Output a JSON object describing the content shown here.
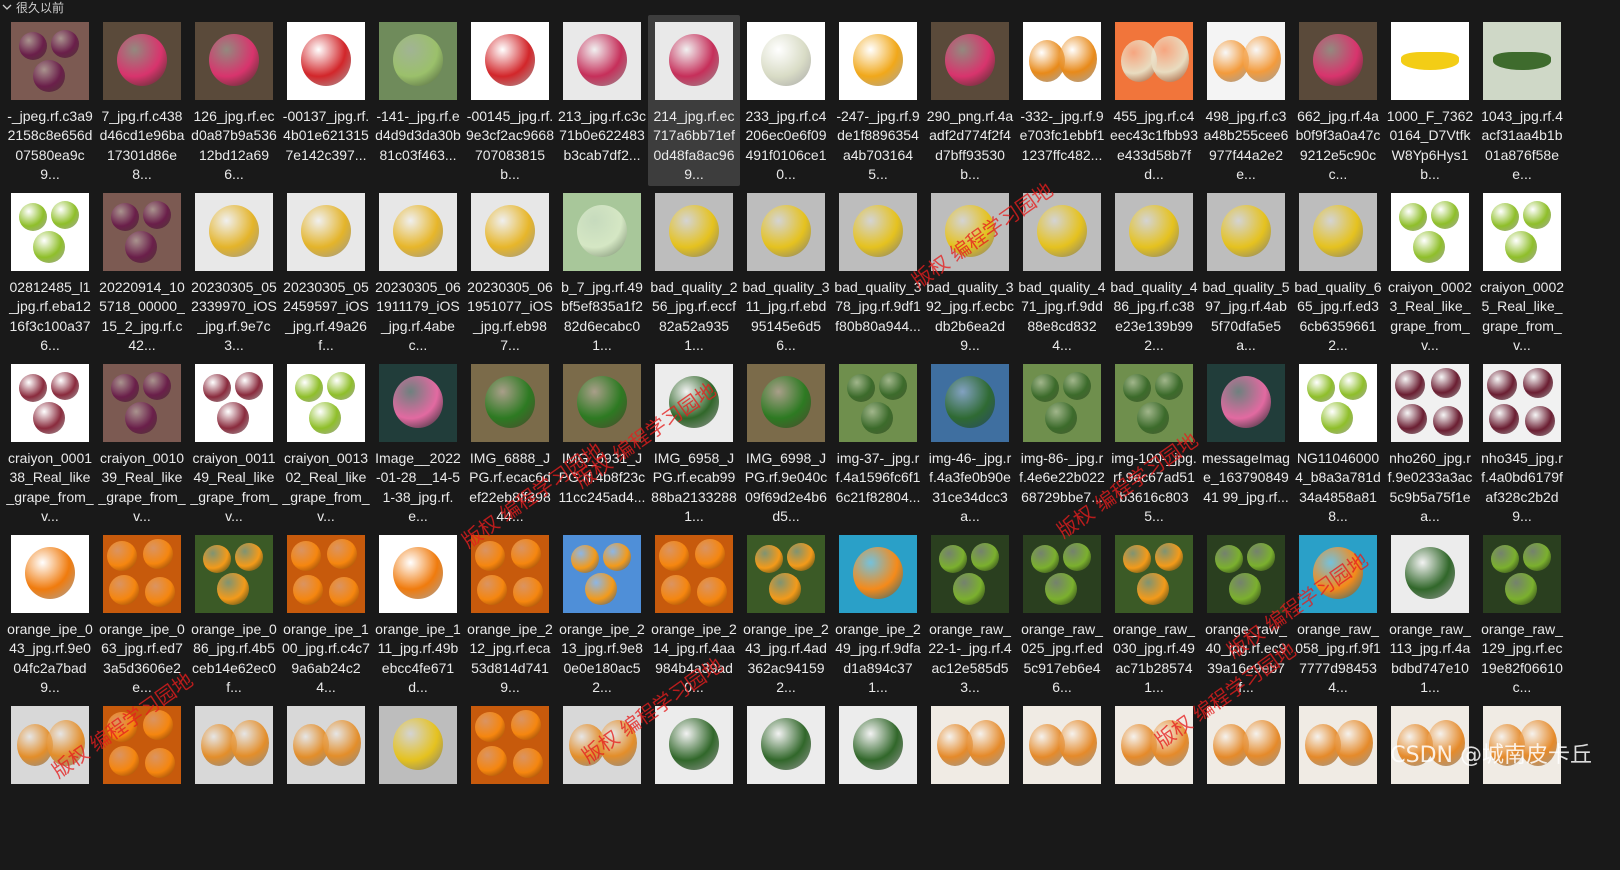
{
  "group": {
    "label": "很久以前"
  },
  "files": [
    {
      "name": "-_jpeg.rf.c3a92158c8e656d07580ea9c9...",
      "thumb": "grapes-purple"
    },
    {
      "name": "7_jpg.rf.c438d46cd1e96ba17301d86e8...",
      "thumb": "dragonfruit"
    },
    {
      "name": "126_jpg.rf.ecd0a87b9a53612bd12a696...",
      "thumb": "dragonfruit"
    },
    {
      "name": "-00137_jpg.rf.4b01e6213157e142c397...",
      "thumb": "apple-red"
    },
    {
      "name": "-141-_jpg.rf.ed4d9d3da30b81c03f463...",
      "thumb": "mango-green"
    },
    {
      "name": "-00145_jpg.rf.9e3cf2ac9668707083815b...",
      "thumb": "apple-red"
    },
    {
      "name": "213_jpg.rf.c3c71b0e622483b3cab7df2...",
      "thumb": "dragonfruit-table"
    },
    {
      "name": "214_jpg.rf.ec717a6bb71ef0d48fa8ac969...",
      "thumb": "dragonfruit-table",
      "selected": true
    },
    {
      "name": "233_jpg.rf.c4206ec0e6f09491f0106ce10...",
      "thumb": "melon"
    },
    {
      "name": "-247-_jpg.rf.9de1f8896354a4b7031645...",
      "thumb": "mango-yellow"
    },
    {
      "name": "290_png.rf.4aadf2d774f2f4d7bff93530b...",
      "thumb": "dragonfruit"
    },
    {
      "name": "-332-_jpg.rf.9e703fc1ebbf11237ffc482...",
      "thumb": "persimmon"
    },
    {
      "name": "455_jpg.rf.c4eec43c1fbb93e433d58b7fd...",
      "thumb": "melon-slices"
    },
    {
      "name": "498_jpg.rf.c3a48b255cee6977f44a2e2e...",
      "thumb": "cantaloupe"
    },
    {
      "name": "662_jpg.rf.4ab0f9f3a0a47c9212e5c90cc...",
      "thumb": "dragonfruit"
    },
    {
      "name": "1000_F_73620164_D7VtfkW8Yp6Hys1b...",
      "thumb": "banana"
    },
    {
      "name": "1043_jpg.rf.4acf31aa4b1b01a876f58ee...",
      "thumb": "leaf"
    },
    {
      "name": "02812485_l1_jpg.rf.eba1216f3c100a376...",
      "thumb": "grapes-green"
    },
    {
      "name": "20220914_105718_00000_15_2_jpg.rf.c42...",
      "thumb": "grapes-purple"
    },
    {
      "name": "20230305_052339970_iOS_jpg.rf.9e7c3...",
      "thumb": "lemon-spot"
    },
    {
      "name": "20230305_052459597_iOS_jpg.rf.49a26f...",
      "thumb": "lemon-spot"
    },
    {
      "name": "20230305_061911179_iOS_jpg.rf.4abec...",
      "thumb": "lemon-dots"
    },
    {
      "name": "20230305_061951077_iOS_jpg.rf.eb987...",
      "thumb": "lemon-dots"
    },
    {
      "name": "b_7_jpg.rf.49bf5ef835a1f282d6ecabc01...",
      "thumb": "pale-green"
    },
    {
      "name": "bad_quality_256_jpg.rf.eccf82a52a9351...",
      "thumb": "lemon-bad"
    },
    {
      "name": "bad_quality_311_jpg.rf.ebd95145e6d56...",
      "thumb": "lemon-bad"
    },
    {
      "name": "bad_quality_378_jpg.rf.9df1f80b80a944...",
      "thumb": "lemon-bad"
    },
    {
      "name": "bad_quality_392_jpg.rf.ecbcdb2b6ea2d9...",
      "thumb": "lemon-bad"
    },
    {
      "name": "bad_quality_471_jpg.rf.9dd88e8cd8324...",
      "thumb": "lemon-bad"
    },
    {
      "name": "bad_quality_486_jpg.rf.c38e23e139b992...",
      "thumb": "lemon-bad"
    },
    {
      "name": "bad_quality_597_jpg.rf.4ab5f70dfa5e5a...",
      "thumb": "lemon-bad"
    },
    {
      "name": "bad_quality_665_jpg.rf.ed36cb63596612...",
      "thumb": "lemon-bad"
    },
    {
      "name": "craiyon_00023_Real_like_grape_from_v...",
      "thumb": "grapes-green"
    },
    {
      "name": "craiyon_00025_Real_like_grape_from_v...",
      "thumb": "grapes-green"
    },
    {
      "name": "craiyon_000138_Real_like_grape_from_v...",
      "thumb": "grapes-red"
    },
    {
      "name": "craiyon_001039_Real_like_grape_from_v...",
      "thumb": "grapes-purple"
    },
    {
      "name": "craiyon_001149_Real_like_grape_from_v...",
      "thumb": "grapes-red"
    },
    {
      "name": "craiyon_001302_Real_like_grape_from_v...",
      "thumb": "grapes-green"
    },
    {
      "name": "Image__2022-01-28__14-51-38_jpg.rf.e...",
      "thumb": "dragonfruit-dark"
    },
    {
      "name": "IMG_6888_JPG.rf.ecac6def22eb8ff39844...",
      "thumb": "lime-mat"
    },
    {
      "name": "IMG_6931_JPG.rf.4b8f23c11cc245ad4...",
      "thumb": "lime-mat"
    },
    {
      "name": "IMG_6958_JPG.rf.ecab9988ba21332881...",
      "thumb": "lime-white"
    },
    {
      "name": "IMG_6998_JPG.rf.9e040c09f69d2e4b6d5...",
      "thumb": "lime-mat"
    },
    {
      "name": "img-37-_jpg.rf.4a1596fc6f16c21f82804...",
      "thumb": "watermelon-field"
    },
    {
      "name": "img-46-_jpg.rf.4a3fe0b90e31ce34dcc3a...",
      "thumb": "watermelon"
    },
    {
      "name": "img-86-_jpg.rf.4e6e22b02268729bbe7...",
      "thumb": "watermelon-field"
    },
    {
      "name": "img-100-_jpg.rf.9ec67ad51b3616c8035...",
      "thumb": "watermelon-field"
    },
    {
      "name": "messageImage_16379084941 99_jpg.rf...",
      "thumb": "dragonfruit-dark"
    },
    {
      "name": "NG110460004_b8a3a781d34a4858a818...",
      "thumb": "grapes-green"
    },
    {
      "name": "nho260_jpg.rf.9e0233a3ac5c9b5a75f1ea...",
      "thumb": "grapes-flat"
    },
    {
      "name": "nho345_jpg.rf.4a0bd6179faf328c2b2d9...",
      "thumb": "grapes-flat"
    },
    {
      "name": "orange_ipe_043_jpg.rf.9e004fc2a7bad9...",
      "thumb": "orange"
    },
    {
      "name": "orange_ipe_063_jpg.rf.ed73a5d3606e2e...",
      "thumb": "oranges-pile"
    },
    {
      "name": "orange_ipe_086_jpg.rf.4b5ceb14e62ec0f...",
      "thumb": "orange-tree"
    },
    {
      "name": "orange_ipe_100_jpg.rf.c4c79a6ab24c24...",
      "thumb": "oranges-pile"
    },
    {
      "name": "orange_ipe_111_jpg.rf.49bebcc4fe671d...",
      "thumb": "orange"
    },
    {
      "name": "orange_ipe_212_jpg.rf.eca53d814d7419...",
      "thumb": "oranges-pile"
    },
    {
      "name": "orange_ipe_213_jpg.rf.9e80e0e180ac52...",
      "thumb": "orange-sky"
    },
    {
      "name": "orange_ipe_214_jpg.rf.4aa984b4a39ad0...",
      "thumb": "oranges-pile"
    },
    {
      "name": "orange_ipe_243_jpg.rf.4ad362ac941592...",
      "thumb": "orange-tree"
    },
    {
      "name": "orange_ipe_249_jpg.rf.9dfad1a894c371...",
      "thumb": "orange-half"
    },
    {
      "name": "orange_raw_22-1-_jpg.rf.4ac12e585d53...",
      "thumb": "green-citrus"
    },
    {
      "name": "orange_raw_025_jpg.rf.ed5c917eb6e46...",
      "thumb": "green-citrus"
    },
    {
      "name": "orange_raw_030_jpg.rf.49ac71b285741...",
      "thumb": "orange-tree"
    },
    {
      "name": "orange_raw_40_jpg.rf.ec939a16e9eb7f...",
      "thumb": "green-citrus"
    },
    {
      "name": "orange_raw_058_jpg.rf.9f17777d984534...",
      "thumb": "orange-half"
    },
    {
      "name": "orange_raw_113_jpg.rf.4abdbd747e101...",
      "thumb": "lime-white"
    },
    {
      "name": "orange_raw_129_jpg.rf.ec19e82f06610c...",
      "thumb": "green-citrus"
    },
    {
      "name": "",
      "thumb": "orange-bad"
    },
    {
      "name": "",
      "thumb": "oranges-pile"
    },
    {
      "name": "",
      "thumb": "orange-bad"
    },
    {
      "name": "",
      "thumb": "orange-bad"
    },
    {
      "name": "",
      "thumb": "lemon-bad"
    },
    {
      "name": "",
      "thumb": "oranges-pile"
    },
    {
      "name": "",
      "thumb": "orange-bad"
    },
    {
      "name": "",
      "thumb": "lime-white"
    },
    {
      "name": "",
      "thumb": "lime-white"
    },
    {
      "name": "",
      "thumb": "lime-white"
    },
    {
      "name": "",
      "thumb": "papaya"
    },
    {
      "name": "",
      "thumb": "papaya"
    },
    {
      "name": "",
      "thumb": "papaya"
    },
    {
      "name": "",
      "thumb": "papaya"
    },
    {
      "name": "",
      "thumb": "papaya"
    },
    {
      "name": "",
      "thumb": "papaya"
    },
    {
      "name": "",
      "thumb": "papaya"
    }
  ],
  "watermarks": [
    {
      "text": "版权 编程学习园地"
    },
    {
      "text": "版权 编程学习园地"
    },
    {
      "text": "版权 编程学习园地"
    },
    {
      "text": "版权 编程学习园地"
    },
    {
      "text": "版权 编程学习园地"
    },
    {
      "text": "版权 编程学习园地"
    },
    {
      "text": "版权 编程学习园地"
    },
    {
      "text": "版权 编程学习园地"
    }
  ],
  "credit": {
    "text": "CSDN @城南皮卡丘"
  }
}
